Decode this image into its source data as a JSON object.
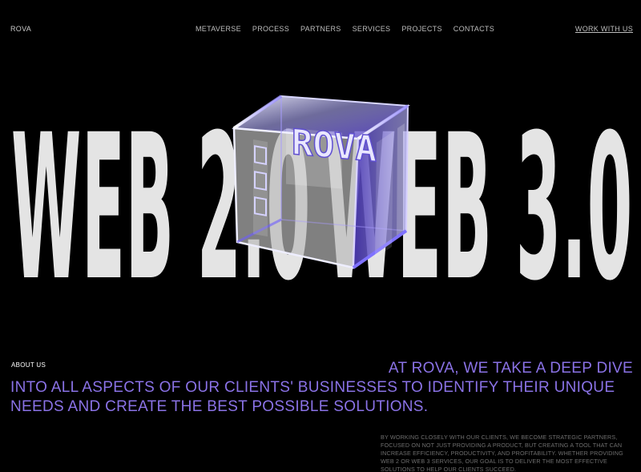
{
  "header": {
    "logo": "ROVA",
    "nav": [
      "METAVERSE",
      "PROCESS",
      "PARTNERS",
      "SERVICES",
      "PROJECTS",
      "CONTACTS"
    ],
    "cta": "WORK WITH US"
  },
  "hero": {
    "left_text": "WEB 2.0",
    "right_text": "WEB 3.0",
    "cube_letters": "ROVA",
    "cube_face_colors": {
      "light": "#d8d8d8",
      "glass": "#7660d9",
      "edge": "#cfcfff"
    }
  },
  "about": {
    "label": "ABOUT US",
    "lead": [
      "AT ROVA, WE TAKE A DEEP DIVE",
      "INTO ALL ASPECTS OF OUR CLIENTS' BUSINESSES TO IDENTIFY THEIR UNIQUE",
      "NEEDS AND CREATE THE BEST POSSIBLE SOLUTIONS."
    ],
    "body_lines": [
      "BY WORKING CLOSELY WITH OUR CLIENTS, WE BECOME STRATEGIC PARTNERS,",
      "FOCUSED ON NOT JUST PROVIDING A PRODUCT, BUT CREATING A TOOL THAT CAN",
      "INCREASE EFFICIENCY, PRODUCTIVITY, AND PROFITABILITY. WHETHER PROVIDING",
      "WEB 2 OR WEB 3 SERVICES, OUR GOAL  IS TO DELIVER THE MOST EFFECTIVE",
      "SOLUTIONS TO HELP OUR CLIENTS SUCCEED."
    ]
  }
}
